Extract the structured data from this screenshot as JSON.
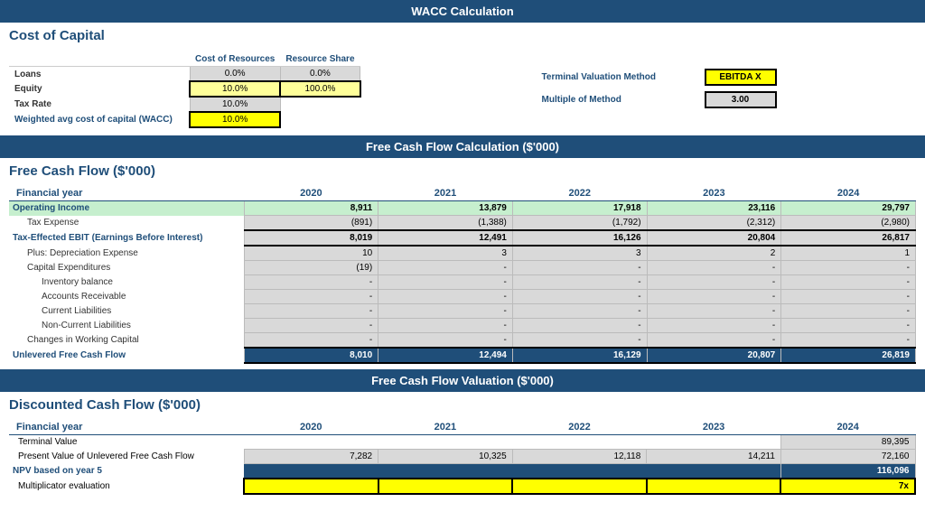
{
  "page_title": "WACC Calculation",
  "wacc": {
    "section_title": "Cost of Capital",
    "col_cost": "Cost of Resources",
    "col_share": "Resource Share",
    "rows": [
      {
        "label": "Loans",
        "cost": "0.0%",
        "share": "0.0%",
        "label_style": "normal"
      },
      {
        "label": "Equity",
        "cost": "10.0%",
        "share": "100.0%",
        "label_style": "normal"
      },
      {
        "label": "Tax Rate",
        "cost": "10.0%",
        "share": "",
        "label_style": "normal"
      },
      {
        "label": "Weighted avg cost of capital (WACC)",
        "cost": "10.0%",
        "share": "",
        "label_style": "bold"
      }
    ],
    "terminal_label": "Terminal Valuation Method",
    "terminal_value": "EBITDA X",
    "multiple_label": "Multiple of Method",
    "multiple_value": "3.00"
  },
  "fcf": {
    "section_header": "Free Cash Flow Calculation ($'000)",
    "section_title": "Free Cash Flow ($'000)",
    "col_label": "Financial year",
    "years": [
      "2020",
      "2021",
      "2022",
      "2023",
      "2024"
    ],
    "rows": [
      {
        "label": "Financial year",
        "indent": 0,
        "style": "header-row",
        "values": [
          "",
          "",
          "",
          "",
          ""
        ]
      },
      {
        "label": "Operating Income",
        "indent": 0,
        "style": "operating",
        "values": [
          "8,911",
          "13,879",
          "17,918",
          "23,116",
          "29,797"
        ]
      },
      {
        "label": "Tax Expense",
        "indent": 1,
        "style": "normal",
        "values": [
          "(891)",
          "(1,388)",
          "(1,792)",
          "(2,312)",
          "(2,980)"
        ]
      },
      {
        "label": "Tax-Effected EBIT (Earnings Before Interest)",
        "indent": 0,
        "style": "bold",
        "values": [
          "8,019",
          "12,491",
          "16,126",
          "20,804",
          "26,817"
        ]
      },
      {
        "label": "Plus: Depreciation Expense",
        "indent": 1,
        "style": "normal",
        "values": [
          "10",
          "3",
          "3",
          "2",
          "1"
        ]
      },
      {
        "label": "Capital Expenditures",
        "indent": 1,
        "style": "normal",
        "values": [
          "(19)",
          "-",
          "-",
          "-",
          "-"
        ]
      },
      {
        "label": "Inventory balance",
        "indent": 2,
        "style": "normal",
        "values": [
          "-",
          "-",
          "-",
          "-",
          "-"
        ]
      },
      {
        "label": "Accounts Receivable",
        "indent": 2,
        "style": "normal",
        "values": [
          "-",
          "-",
          "-",
          "-",
          "-"
        ]
      },
      {
        "label": "Current Liabilities",
        "indent": 2,
        "style": "normal",
        "values": [
          "-",
          "-",
          "-",
          "-",
          "-"
        ]
      },
      {
        "label": "Non-Current Liabilities",
        "indent": 2,
        "style": "normal",
        "values": [
          "-",
          "-",
          "-",
          "-",
          "-"
        ]
      },
      {
        "label": "Changes in Working Capital",
        "indent": 1,
        "style": "normal",
        "values": [
          "-",
          "-",
          "-",
          "-",
          "-"
        ]
      },
      {
        "label": "Unlevered Free Cash Flow",
        "indent": 0,
        "style": "unlevered",
        "values": [
          "8,010",
          "12,494",
          "16,129",
          "20,807",
          "26,819"
        ]
      }
    ]
  },
  "dcf": {
    "section_header": "Free Cash Flow Valuation ($'000)",
    "section_title": "Discounted Cash Flow ($'000)",
    "years": [
      "2020",
      "2021",
      "2022",
      "2023",
      "2024"
    ],
    "rows": [
      {
        "label": "Financial year",
        "indent": 0,
        "style": "header-row",
        "values": [
          "",
          "",
          "",
          "",
          ""
        ]
      },
      {
        "label": "Terminal Value",
        "indent": 1,
        "style": "normal",
        "values": [
          "",
          "",
          "",
          "",
          "89,395"
        ]
      },
      {
        "label": "Present Value of Unlevered Free Cash Flow",
        "indent": 1,
        "style": "normal",
        "values": [
          "7,282",
          "10,325",
          "12,118",
          "14,211",
          "72,160"
        ]
      },
      {
        "label": "NPV based on year 5",
        "indent": 0,
        "style": "npv",
        "values": [
          "",
          "",
          "",
          "",
          "116,096"
        ]
      },
      {
        "label": "Multiplicator evaluation",
        "indent": 1,
        "style": "mult",
        "values": [
          "",
          "",
          "",
          "",
          "7x"
        ]
      }
    ]
  }
}
